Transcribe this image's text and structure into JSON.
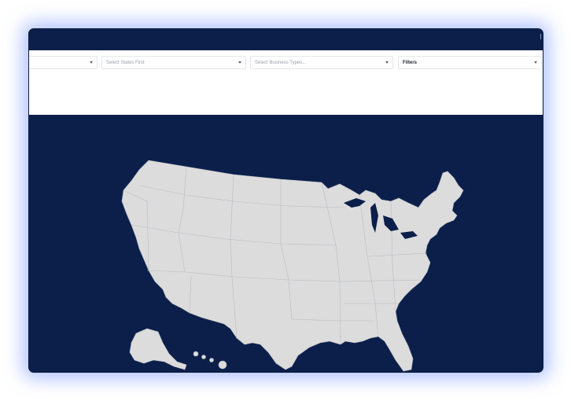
{
  "filters": {
    "first_dropdown": "",
    "states_placeholder": "Select States First",
    "business_types_placeholder": "Select Business Types...",
    "filters_label": "Filters"
  },
  "map": {
    "region": "United States",
    "fill_color": "#dcdcdc",
    "background_color": "#0b1f4a"
  },
  "colors": {
    "header": "#0b1f4a",
    "panel": "#ffffff",
    "glow": "#7896ff"
  }
}
